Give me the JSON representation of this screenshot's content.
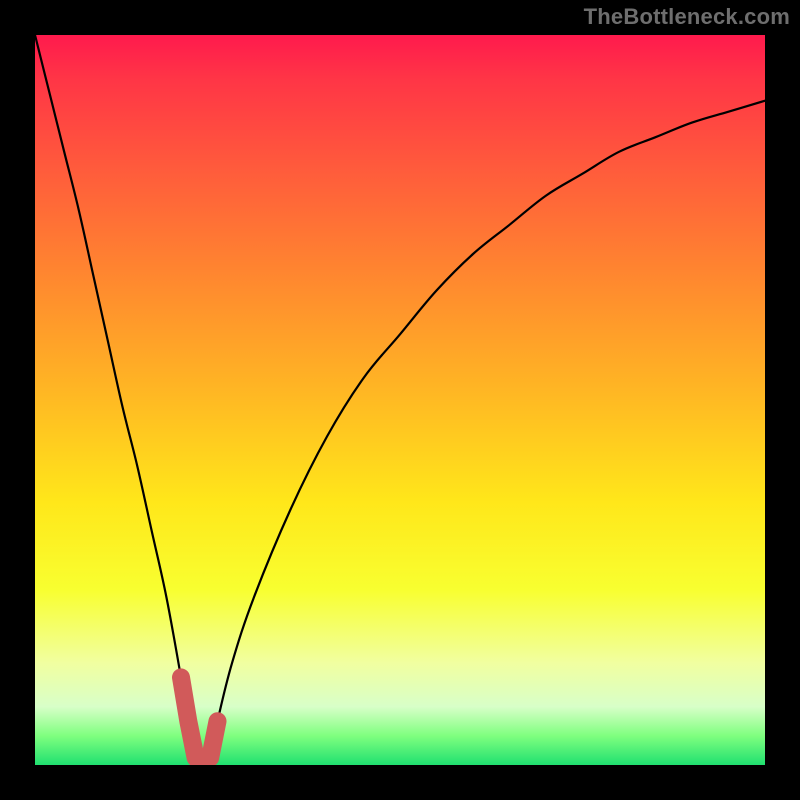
{
  "watermark": {
    "text": "TheBottleneck.com"
  },
  "chart_data": {
    "type": "line",
    "title": "",
    "xlabel": "",
    "ylabel": "",
    "xlim": [
      0,
      100
    ],
    "ylim": [
      0,
      100
    ],
    "background_gradient": {
      "top": "#ff1a4d",
      "mid": "#ffe71a",
      "bottom": "#20e070",
      "meaning": "red-high → green-low bottleneck scale"
    },
    "series": [
      {
        "name": "bottleneck-curve",
        "x": [
          0,
          2,
          4,
          6,
          8,
          10,
          12,
          14,
          16,
          18,
          20,
          21,
          22,
          23,
          24,
          25,
          27,
          30,
          35,
          40,
          45,
          50,
          55,
          60,
          65,
          70,
          75,
          80,
          85,
          90,
          95,
          100
        ],
        "y": [
          100,
          92,
          84,
          76,
          67,
          58,
          49,
          41,
          32,
          23,
          12,
          6,
          1,
          0,
          1,
          6,
          14,
          23,
          35,
          45,
          53,
          59,
          65,
          70,
          74,
          78,
          81,
          84,
          86,
          88,
          89.5,
          91
        ]
      }
    ],
    "annotations": [
      {
        "name": "valley-highlight",
        "type": "polyline",
        "color": "#d15a5a",
        "x": [
          20,
          21,
          22,
          23,
          24,
          25
        ],
        "y": [
          12,
          6,
          1,
          0,
          1,
          6
        ],
        "note": "thick rounded highlight at curve minimum near bottom of plot"
      }
    ]
  }
}
